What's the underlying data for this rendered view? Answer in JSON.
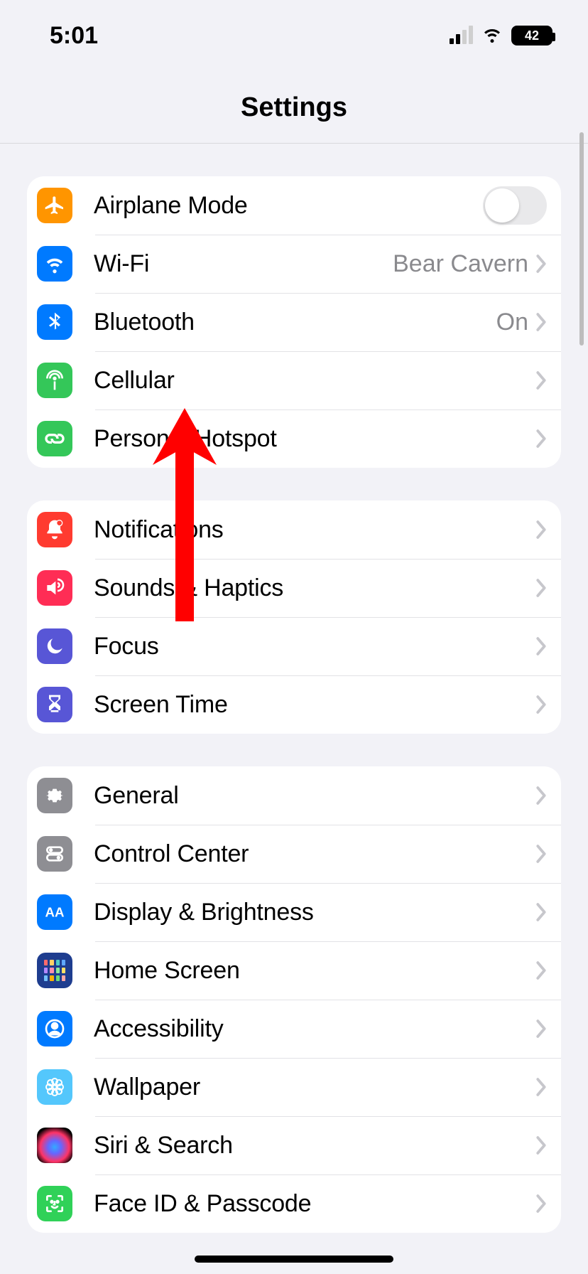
{
  "status": {
    "time": "5:01",
    "battery_pct": "42"
  },
  "nav": {
    "title": "Settings"
  },
  "groups": [
    {
      "rows": [
        {
          "key": "airplane",
          "label": "Airplane Mode",
          "type": "toggle",
          "on": false,
          "icon": "airplane",
          "bg": "bg-orange"
        },
        {
          "key": "wifi",
          "label": "Wi-Fi",
          "value": "Bear Cavern",
          "type": "link",
          "icon": "wifi",
          "bg": "bg-blue"
        },
        {
          "key": "bluetooth",
          "label": "Bluetooth",
          "value": "On",
          "type": "link",
          "icon": "bluetooth",
          "bg": "bg-blue"
        },
        {
          "key": "cellular",
          "label": "Cellular",
          "type": "link",
          "icon": "antenna",
          "bg": "bg-green"
        },
        {
          "key": "hotspot",
          "label": "Personal Hotspot",
          "type": "link",
          "icon": "link",
          "bg": "bg-green"
        }
      ]
    },
    {
      "rows": [
        {
          "key": "notifications",
          "label": "Notifications",
          "type": "link",
          "icon": "bell",
          "bg": "bg-red"
        },
        {
          "key": "sounds",
          "label": "Sounds & Haptics",
          "type": "link",
          "icon": "speaker",
          "bg": "bg-pink"
        },
        {
          "key": "focus",
          "label": "Focus",
          "type": "link",
          "icon": "moon",
          "bg": "bg-indigo"
        },
        {
          "key": "screentime",
          "label": "Screen Time",
          "type": "link",
          "icon": "hourglass",
          "bg": "bg-indigo"
        }
      ]
    },
    {
      "rows": [
        {
          "key": "general",
          "label": "General",
          "type": "link",
          "icon": "gear",
          "bg": "bg-gray"
        },
        {
          "key": "controlcenter",
          "label": "Control Center",
          "type": "link",
          "icon": "switches",
          "bg": "bg-gray"
        },
        {
          "key": "display",
          "label": "Display & Brightness",
          "type": "link",
          "icon": "aa",
          "bg": "bg-blue"
        },
        {
          "key": "homescreen",
          "label": "Home Screen",
          "type": "link",
          "icon": "homegrid",
          "bg": "icon-home"
        },
        {
          "key": "accessibility",
          "label": "Accessibility",
          "type": "link",
          "icon": "person",
          "bg": "bg-blue"
        },
        {
          "key": "wallpaper",
          "label": "Wallpaper",
          "type": "link",
          "icon": "flower",
          "bg": "bg-lightblue"
        },
        {
          "key": "siri",
          "label": "Siri & Search",
          "type": "link",
          "icon": "siri",
          "bg": "bg-black icon-siri"
        },
        {
          "key": "faceid",
          "label": "Face ID & Passcode",
          "type": "link",
          "icon": "faceid",
          "bg": "bg-green2"
        }
      ]
    }
  ],
  "annotation": {
    "type": "arrow",
    "color": "#ff0000",
    "points_to": "hotspot"
  }
}
